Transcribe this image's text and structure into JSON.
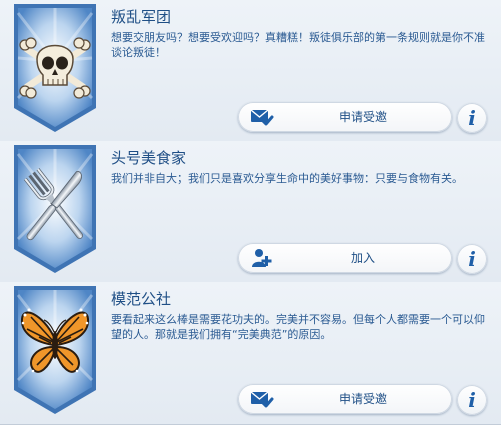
{
  "clubs": [
    {
      "name": "叛乱军团",
      "description": "想要交朋友吗？想要受欢迎吗？真糟糕！叛徒俱乐部的第一条规则就是你不准谈论叛徒！",
      "emblem_icon": "skull-crossbones-icon",
      "action": {
        "label": "申请受邀",
        "icon": "envelope-check-icon"
      },
      "info_label": "i"
    },
    {
      "name": "头号美食家",
      "description": "我们并非自大；我们只是喜欢分享生命中的美好事物：只要与食物有关。",
      "emblem_icon": "fork-knife-icon",
      "action": {
        "label": "加入",
        "icon": "add-member-icon"
      },
      "info_label": "i"
    },
    {
      "name": "模范公社",
      "description": "要看起来这么棒是需要花功夫的。完美并不容易。但每个人都需要一个可以仰望的人。那就是我们拥有“完美典范”的原因。",
      "emblem_icon": "butterfly-icon",
      "action": {
        "label": "申请受邀",
        "icon": "envelope-check-icon"
      },
      "info_label": "i"
    }
  ],
  "colors": {
    "text_primary": "#1f4f86",
    "shield_blue": "#4f86c6",
    "shield_light": "#dce9f7",
    "background": "#d6e0ea"
  }
}
